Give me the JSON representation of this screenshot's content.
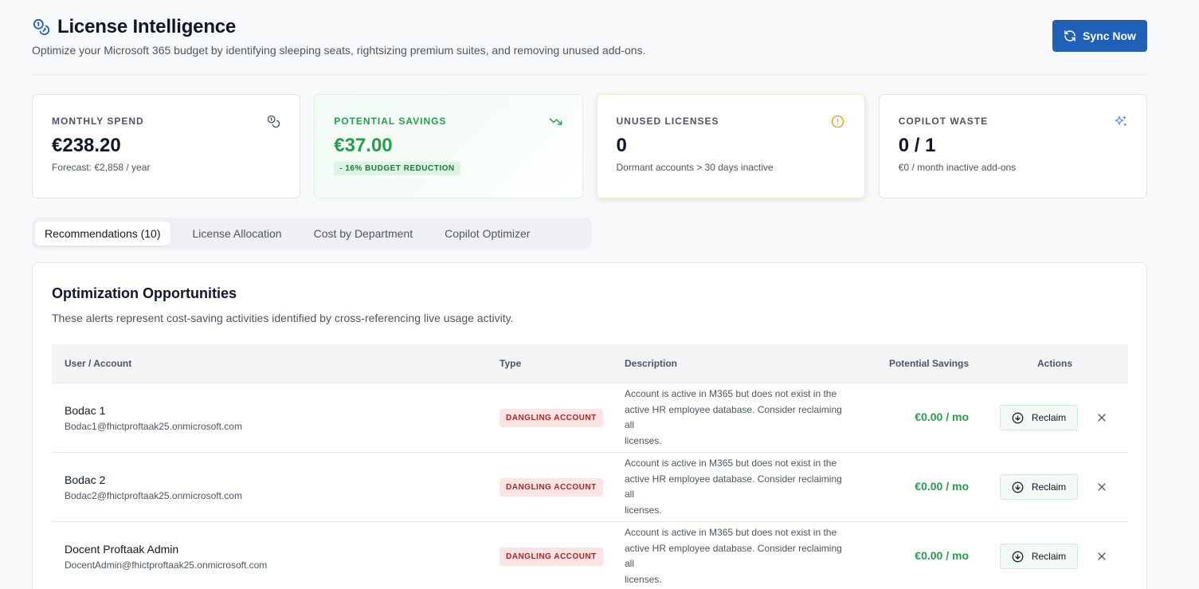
{
  "header": {
    "title": "License Intelligence",
    "subtitle": "Optimize your Microsoft 365 budget by identifying sleeping seats, rightsizing premium suites, and removing unused add-ons.",
    "sync_label": "Sync Now",
    "title_icon": "coins-icon",
    "sync_icon": "refresh-icon"
  },
  "kpis": [
    {
      "label": "MONTHLY SPEND",
      "value": "€238.20",
      "sub": "Forecast: €2,858 / year",
      "icon": "coins-icon"
    },
    {
      "label": "POTENTIAL SAVINGS",
      "value": "€37.00",
      "badge": "- 16% BUDGET REDUCTION",
      "icon": "trending-down-icon"
    },
    {
      "label": "UNUSED LICENSES",
      "value": "0",
      "sub": "Dormant accounts > 30 days inactive",
      "icon": "alert-circle-icon"
    },
    {
      "label": "COPILOT WASTE",
      "value": "0 / 1",
      "sub": "€0 / month inactive add-ons",
      "icon": "sparkles-icon"
    }
  ],
  "tabs": [
    {
      "label": "Recommendations (10)",
      "active": true
    },
    {
      "label": "License Allocation"
    },
    {
      "label": "Cost by Department"
    },
    {
      "label": "Copilot Optimizer"
    }
  ],
  "panel": {
    "title": "Optimization Opportunities",
    "description": "These alerts represent cost-saving activities identified by cross-referencing live usage activity.",
    "columns": {
      "user": "User / Account",
      "type": "Type",
      "description": "Description",
      "savings": "Potential Savings",
      "actions": "Actions"
    },
    "rows": [
      {
        "name": "Bodac 1",
        "email": "Bodac1@fhictproftaak25.onmicrosoft.com",
        "type": "DANGLING ACCOUNT",
        "desc1": "Account is active in M365 but does not exist in the",
        "desc2": "active HR employee database. Consider reclaiming all",
        "desc3": "licenses.",
        "savings": "€0.00 / mo",
        "action": "Reclaim"
      },
      {
        "name": "Bodac 2",
        "email": "Bodac2@fhictproftaak25.onmicrosoft.com",
        "type": "DANGLING ACCOUNT",
        "desc1": "Account is active in M365 but does not exist in the",
        "desc2": "active HR employee database. Consider reclaiming all",
        "desc3": "licenses.",
        "savings": "€0.00 / mo",
        "action": "Reclaim"
      },
      {
        "name": "Docent Proftaak Admin",
        "email": "DocentAdmin@fhictproftaak25.onmicrosoft.com",
        "type": "DANGLING ACCOUNT",
        "desc1": "Account is active in M365 but does not exist in the",
        "desc2": "active HR employee database. Consider reclaiming all",
        "desc3": "licenses.",
        "savings": "€0.00 / mo",
        "action": "Reclaim"
      }
    ]
  },
  "colors": {
    "primary": "#2160b8",
    "success": "#22a04b",
    "danger_bg": "#fde4e4",
    "danger_text": "#b42323",
    "warning": "#e8a317"
  }
}
